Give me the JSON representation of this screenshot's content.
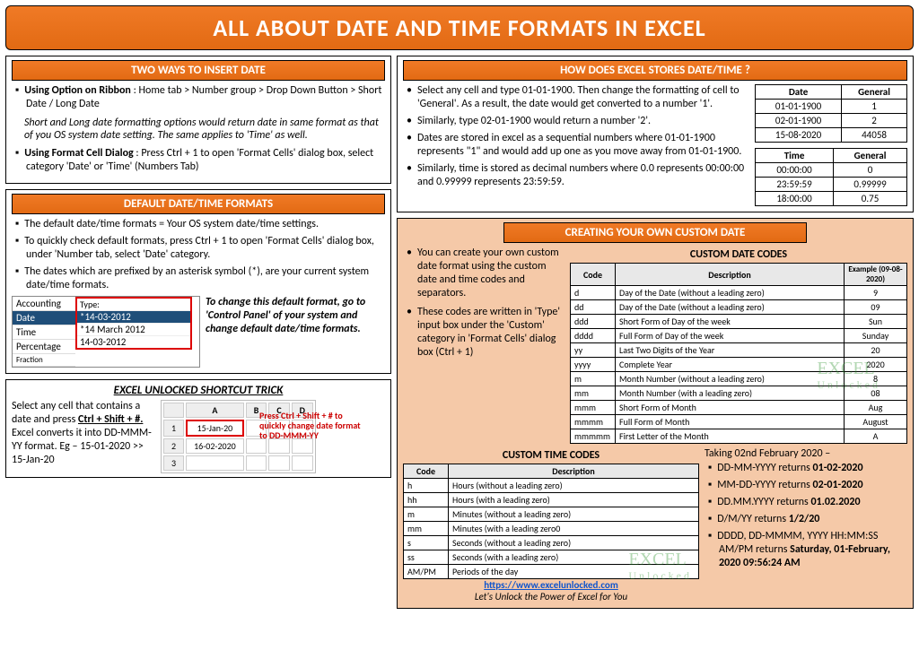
{
  "title": "ALL ABOUT DATE AND TIME FORMATS IN EXCEL",
  "section1": {
    "head": "TWO WAYS TO INSERT DATE",
    "b1_label": "Using Option on Ribbon",
    "b1_text": " : Home tab > Number group > Drop Down Button > Short Date / Long Date",
    "note": "Short and Long date formatting options would return date in same format as that of you OS system date setting. The same applies to 'Time' as well.",
    "b2_label": "Using Format Cell Dialog",
    "b2_text": " : Press Ctrl + 1 to open 'Format Cells' dialog box, select category 'Date' or 'Time' (Numbers Tab)"
  },
  "section2": {
    "head": "HOW DOES EXCEL STORES DATE/TIME ?",
    "b1": "Select any cell and type 01-01-1900. Then change the formatting of cell to 'General'. As a result, the date would get converted to a number '1'.",
    "b2": "Similarly, type 02-01-1900 would return a number '2'.",
    "b3": "Dates are stored in excel as a sequential numbers where 01-01-1900 represents \"1\" and would add up one as you move away from 01-01-1900.",
    "b4": "Similarly, time is stored as decimal numbers where 0.0 represents 00:00:00 and 0.99999 represents 23:59:59.",
    "date_table": {
      "h1": "Date",
      "h2": "General",
      "rows": [
        [
          "01-01-1900",
          "1"
        ],
        [
          "02-01-1900",
          "2"
        ],
        [
          "15-08-2020",
          "44058"
        ]
      ]
    },
    "time_table": {
      "h1": "Time",
      "h2": "General",
      "rows": [
        [
          "00:00:00",
          "0"
        ],
        [
          "23:59:59",
          "0.99999"
        ],
        [
          "18:00:00",
          "0.75"
        ]
      ]
    }
  },
  "section3": {
    "head": "DEFAULT DATE/TIME FORMATS",
    "b1": "The default date/time formats = Your OS system date/time settings.",
    "b2": "To quickly check default formats, press Ctrl + 1 to open 'Format Cells' dialog box, under 'Number tab, select 'Date' category.",
    "b3": "The dates which are prefixed by an asterisk symbol (*), are your current system date/time formats.",
    "shot": {
      "cats": [
        "Accounting",
        "Date",
        "Time",
        "Percentage",
        "Fraction"
      ],
      "sel_cat_idx": 1,
      "type_label": "Type:",
      "types": [
        "*14-03-2012",
        "*14 March 2012",
        "14-03-2012"
      ],
      "sel_type_idx": 0
    },
    "tip": "To change this default format, go to 'Control Panel' of your system and change default date/time formats."
  },
  "trick": {
    "title": "EXCEL UNLOCKED SHORTCUT TRICK",
    "text_pre": "Select any cell that contains a date and press ",
    "text_key": "Ctrl + Shift + #.",
    "text_post": " Excel converts it into DD-MMM-YY format. Eg – 15-01-2020 >> 15-Jan-20",
    "sheet": {
      "cols": [
        "",
        "A",
        "B",
        "C",
        "D"
      ],
      "rows": [
        [
          "1",
          "15-Jan-20",
          "",
          "",
          ""
        ],
        [
          "2",
          "16-02-2020",
          "",
          "",
          ""
        ],
        [
          "3",
          "",
          "",
          "",
          ""
        ]
      ]
    },
    "callout": "Press Ctrl + Shift + # to quickly change date format to DD-MMM-YY"
  },
  "section4": {
    "head": "CREATING YOUR OWN CUSTOM DATE",
    "b1": "You can create your own custom date format using the custom date and time codes and separators.",
    "b2": "These codes are written in 'Type' input box under the 'Custom' category in 'Format Cells' dialog box (Ctrl + 1)",
    "date_codes_title": "CUSTOM DATE CODES",
    "date_codes": {
      "h": [
        "Code",
        "Description",
        "Example (09-08-2020)"
      ],
      "rows": [
        [
          "d",
          "Day of the Date (without a leading zero)",
          "9"
        ],
        [
          "dd",
          "Day of the Date (without a leading zero)",
          "09"
        ],
        [
          "ddd",
          "Short Form of Day of the week",
          "Sun"
        ],
        [
          "dddd",
          "Full Form of Day of the week",
          "Sunday"
        ],
        [
          "yy",
          "Last Two Digits of the Year",
          "20"
        ],
        [
          "yyyy",
          "Complete Year",
          "2020"
        ],
        [
          "m",
          "Month Number (without a leading zero)",
          "8"
        ],
        [
          "mm",
          "Month Number (with a leading zero)",
          "08"
        ],
        [
          "mmm",
          "Short Form of Month",
          "Aug"
        ],
        [
          "mmmm",
          "Full Form of Month",
          "August"
        ],
        [
          "mmmmm",
          "First Letter of the Month",
          "A"
        ]
      ]
    },
    "time_codes_title": "CUSTOM TIME CODES",
    "time_codes": {
      "h": [
        "Code",
        "Description"
      ],
      "rows": [
        [
          "h",
          "Hours (without a leading zero)"
        ],
        [
          "hh",
          "Hours (with a leading zero)"
        ],
        [
          "m",
          "Minutes (without a leading zero)"
        ],
        [
          "mm",
          "Minutes (with a leading zero0"
        ],
        [
          "s",
          "Seconds (without a leading zero)"
        ],
        [
          "ss",
          "Seconds (with a leading zero)"
        ],
        [
          "AM/PM",
          "Periods of the day"
        ]
      ]
    },
    "example_head": "Taking 02nd February 2020 –",
    "ex1_a": "DD-MM-YYYY returns ",
    "ex1_b": "01-02-2020",
    "ex2_a": "MM-DD-YYYY returns ",
    "ex2_b": "02-01-2020",
    "ex3_a": "DD.MM.YYYY returns ",
    "ex3_b": "01.02.2020",
    "ex4_a": "D/M/YY returns ",
    "ex4_b": "1/2/20",
    "ex5_a": "DDDD, DD-MMMM, YYYY HH:MM:SS AM/PM returns ",
    "ex5_b": "Saturday, 01-February, 2020 09:56:24 AM",
    "url": "https://www.excelunlocked.com",
    "tagline": "Let's Unlock the Power of Excel for You"
  },
  "watermark": {
    "line1": "EXCEL",
    "line2": "Unlocked"
  }
}
